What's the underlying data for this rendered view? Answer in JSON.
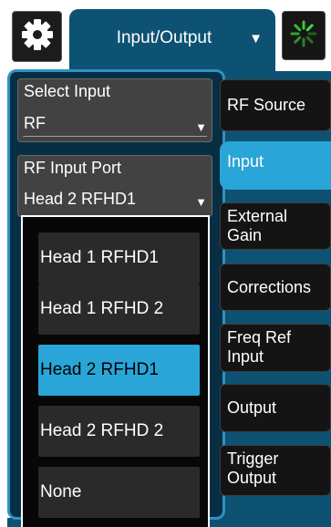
{
  "header": {
    "settings_icon": "gear-icon",
    "title": "Input/Output",
    "title_caret": "▼",
    "status_icon": "busy-spinner-icon",
    "status_color": "#3be23b"
  },
  "settings": {
    "select_input": {
      "label": "Select Input",
      "value": "RF",
      "caret": "▼"
    },
    "rf_input_port": {
      "label": "RF Input Port",
      "value": "Head 2 RFHD1",
      "caret": "▼",
      "options": [
        {
          "label": "Head 1 RFHD1",
          "selected": false
        },
        {
          "label": "Head 1 RFHD 2",
          "selected": false
        },
        {
          "label": "Head 2 RFHD1",
          "selected": true
        },
        {
          "label": "Head 2 RFHD 2",
          "selected": false
        },
        {
          "label": "None",
          "selected": false
        }
      ]
    }
  },
  "menu": {
    "items": [
      {
        "line1": "RF Source",
        "line2": "",
        "active": false
      },
      {
        "line1": "Input",
        "line2": "",
        "active": true
      },
      {
        "line1": "External",
        "line2": "Gain",
        "active": false
      },
      {
        "line1": "Corrections",
        "line2": "",
        "active": false
      },
      {
        "line1": "Freq Ref",
        "line2": "Input",
        "active": false
      },
      {
        "line1": "Output",
        "line2": "",
        "active": false
      },
      {
        "line1": "Trigger",
        "line2": "Output",
        "active": false
      }
    ]
  },
  "colors": {
    "accent": "#2aa5d8",
    "panel": "#082e44",
    "tab": "#0d5272"
  }
}
